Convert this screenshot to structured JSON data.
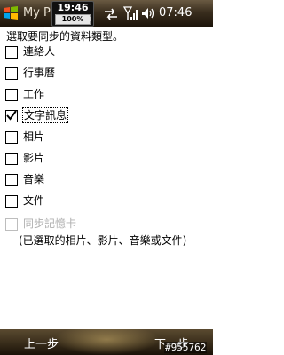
{
  "titlebar": {
    "app_title": "My Phone",
    "clock_time": "19:46",
    "battery": "100%",
    "time": "07:46",
    "icons": [
      "windows-start-icon",
      "sync-arrows-icon",
      "signal-icon",
      "volume-icon"
    ]
  },
  "instruction": "選取要同步的資料類型。",
  "options": [
    {
      "label": "連絡人",
      "checked": false,
      "enabled": true
    },
    {
      "label": "行事曆",
      "checked": false,
      "enabled": true
    },
    {
      "label": "工作",
      "checked": false,
      "enabled": true
    },
    {
      "label": "文字訊息",
      "checked": true,
      "enabled": true,
      "focused": true
    },
    {
      "label": "相片",
      "checked": false,
      "enabled": true
    },
    {
      "label": "影片",
      "checked": false,
      "enabled": true
    },
    {
      "label": "音樂",
      "checked": false,
      "enabled": true
    },
    {
      "label": "文件",
      "checked": false,
      "enabled": true
    },
    {
      "label": "同步記憶卡",
      "checked": false,
      "enabled": false
    }
  ],
  "note": "(已選取的相片、影片、音樂或文件)",
  "softkeys": {
    "left": "上一步",
    "right": "下一步"
  },
  "watermark": "#955762",
  "colors": {
    "bar_dark": "#1c140a",
    "bar_light": "#6a5a42",
    "disabled_text": "#b0b0b0"
  }
}
